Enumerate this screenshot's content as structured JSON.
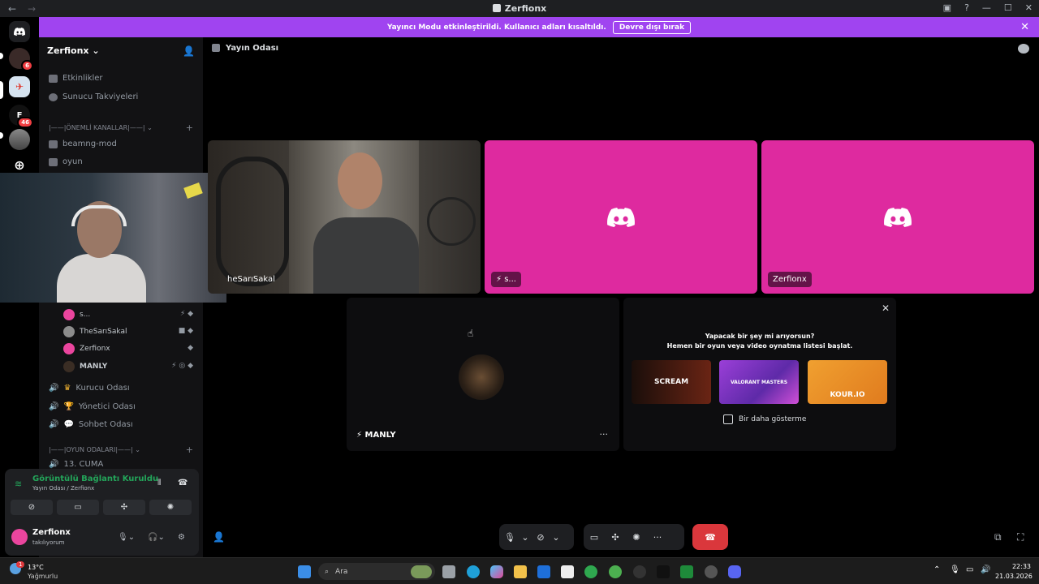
{
  "window": {
    "title": "Zerfionx"
  },
  "banner": {
    "text": "Yayıncı Modu etkinleştirildi. Kullanıcı adları kısaltıldı.",
    "button": "Devre dışı bırak"
  },
  "rail": {
    "badges": [
      "6",
      "46"
    ],
    "f_label": "F"
  },
  "sidebar": {
    "server_name": "Zerfionx",
    "items": [
      {
        "label": "Etkinlikler"
      },
      {
        "label": "Sunucu Takviyeleri"
      }
    ],
    "category_important": "|——|ÖNEMLİ KANALLAR|——|",
    "channels_text": [
      "beamng-mod",
      "oyun"
    ],
    "voice_users": [
      {
        "name": "s..."
      },
      {
        "name": "TheSarıSakal"
      },
      {
        "name": "Zerfionx"
      },
      {
        "name": "MANLY"
      }
    ],
    "voice_channels": [
      "Kurucu Odası",
      "Yönetici Odası",
      "Sohbet Odası"
    ],
    "category_games": "|——|OYUN ODALARI|——|",
    "partial_channel": "13. CUMA"
  },
  "voice_panel": {
    "status": "Görüntülü Bağlantı Kuruldu",
    "sub": "Yayın Odası / Zerfionx",
    "user_name": "Zerfionx",
    "user_status": "takılıyorum"
  },
  "stage": {
    "channel_title": "Yayın Odası",
    "tiles": [
      {
        "name": "heSarıSakal"
      },
      {
        "name": "s..."
      },
      {
        "name": "Zerfionx"
      },
      {
        "name": "MANLY"
      }
    ],
    "activity": {
      "line1": "Yapacak bir şey mi arıyorsun?",
      "line2": "Hemen bir oyun veya video oynatma listesi başlat.",
      "cards": [
        "SCREAM",
        "VALORANT MASTERS",
        "KOUR.IO"
      ],
      "checkbox_label": "Bir daha gösterme"
    }
  },
  "taskbar": {
    "weather_temp": "13°C",
    "weather_desc": "Yağmurlu",
    "weather_badge": "1",
    "search_placeholder": "Ara",
    "time": "22:33",
    "date": "21.03.2026"
  },
  "colors": {
    "banner": "#a044f0",
    "pink_tile": "#de2a9f",
    "connected_green": "#23a55a",
    "hangup_red": "#da373c"
  }
}
